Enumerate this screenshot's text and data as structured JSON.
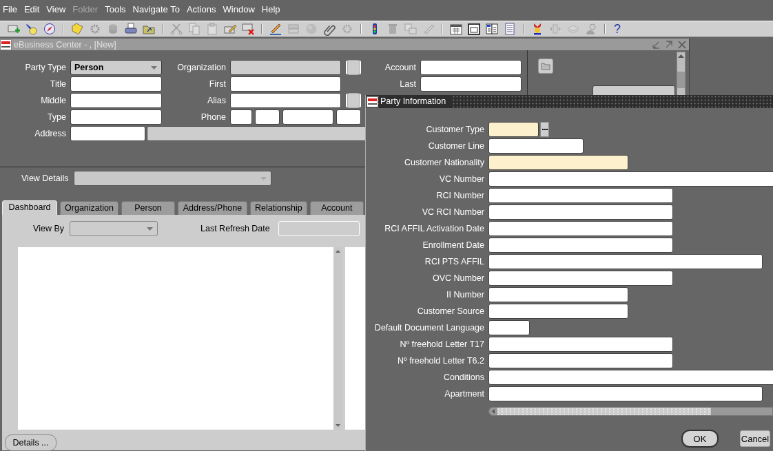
{
  "menu": [
    {
      "label": "File",
      "disabled": false
    },
    {
      "label": "Edit",
      "disabled": false
    },
    {
      "label": "View",
      "disabled": false
    },
    {
      "label": "Folder",
      "disabled": true
    },
    {
      "label": "Tools",
      "disabled": false
    },
    {
      "label": "Navigate To",
      "disabled": false
    },
    {
      "label": "Actions",
      "disabled": false
    },
    {
      "label": "Window",
      "disabled": false
    },
    {
      "label": "Help",
      "disabled": false
    }
  ],
  "toolbar": {
    "groups": [
      [
        {
          "disabled": false
        },
        {
          "disabled": false
        },
        {
          "disabled": false
        }
      ],
      [
        {
          "disabled": false
        },
        {
          "disabled": true
        },
        {
          "disabled": true
        },
        {
          "disabled": false
        },
        {
          "disabled": false
        }
      ],
      [
        {
          "disabled": true
        },
        {
          "disabled": true
        },
        {
          "disabled": true
        },
        {
          "disabled": false
        },
        {
          "disabled": false
        }
      ],
      [
        {
          "disabled": false
        },
        {
          "disabled": true
        },
        {
          "disabled": true
        },
        {
          "disabled": false
        },
        {
          "disabled": true
        }
      ],
      [
        {
          "disabled": false
        },
        {
          "disabled": true
        },
        {
          "disabled": true
        },
        {
          "disabled": true
        }
      ],
      [
        {
          "disabled": false
        },
        {
          "disabled": false
        },
        {
          "disabled": false
        },
        {
          "disabled": false
        }
      ],
      [
        {
          "disabled": false
        },
        {
          "disabled": true
        },
        {
          "disabled": true
        },
        {
          "disabled": true
        }
      ]
    ],
    "help_glyph": "?"
  },
  "window": {
    "title": "eBusiness Center - , [New]"
  },
  "header_form": {
    "party_type": {
      "label": "Party Type",
      "value": "Person"
    },
    "organization": {
      "label": "Organization",
      "disabled": true
    },
    "account": {
      "label": "Account"
    },
    "title": {
      "label": "Title"
    },
    "first": {
      "label": "First"
    },
    "last": {
      "label": "Last"
    },
    "middle": {
      "label": "Middle"
    },
    "alias": {
      "label": "Alias"
    },
    "type": {
      "label": "Type"
    },
    "phone": {
      "label": "Phone"
    },
    "address": {
      "label": "Address",
      "detail_disabled": true
    }
  },
  "view_details": {
    "label": "View Details",
    "disabled": true
  },
  "tabs": [
    {
      "label": "Dashboard",
      "selected": true
    },
    {
      "label": "Organization",
      "selected": false
    },
    {
      "label": "Person",
      "selected": false
    },
    {
      "label": "Address/Phone",
      "selected": false
    },
    {
      "label": "Relationship",
      "selected": false
    },
    {
      "label": "Account",
      "selected": false
    }
  ],
  "dashboard": {
    "view_by": {
      "label": "View By"
    },
    "last_refresh_date": {
      "label": "Last Refresh Date"
    },
    "details_button": "Details ..."
  },
  "dialog": {
    "title": "Party Information",
    "fields": [
      {
        "label": "Customer Type",
        "required": true,
        "kind": "lov"
      },
      {
        "label": "Customer Line",
        "required": false,
        "kind": "text"
      },
      {
        "label": "Customer Nationality",
        "required": true,
        "kind": "text"
      },
      {
        "label": "VC Number",
        "required": false,
        "kind": "text"
      },
      {
        "label": "RCI Number",
        "required": false,
        "kind": "text"
      },
      {
        "label": "VC RCI Number",
        "required": false,
        "kind": "text"
      },
      {
        "label": "RCI AFFIL Activation Date",
        "required": false,
        "kind": "text"
      },
      {
        "label": "Enrollment Date",
        "required": false,
        "kind": "text"
      },
      {
        "label": "RCI PTS AFFIL",
        "required": false,
        "kind": "text"
      },
      {
        "label": "OVC Number",
        "required": false,
        "kind": "text"
      },
      {
        "label": "II Number",
        "required": false,
        "kind": "text"
      },
      {
        "label": "Customer Source",
        "required": false,
        "kind": "text"
      },
      {
        "label": "Default Document Language",
        "required": false,
        "kind": "text"
      },
      {
        "label": "Nº freehold Letter T17",
        "required": false,
        "kind": "text"
      },
      {
        "label": "Nº freehold Letter T6.2",
        "required": false,
        "kind": "text"
      },
      {
        "label": "Conditions",
        "required": false,
        "kind": "text"
      },
      {
        "label": "Apartment",
        "required": false,
        "kind": "text"
      }
    ],
    "buttons": [
      {
        "label": "OK",
        "default": true
      },
      {
        "label": "Cancel",
        "default": false
      }
    ]
  }
}
